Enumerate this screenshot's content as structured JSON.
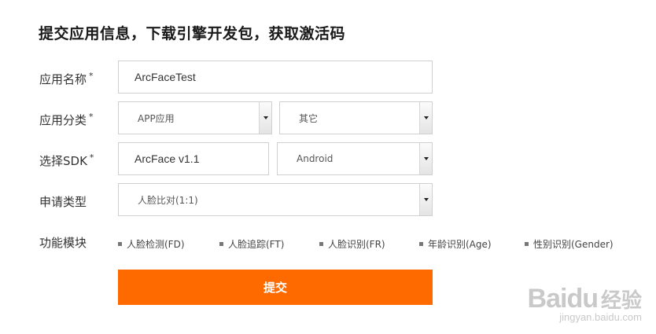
{
  "title": "提交应用信息，下载引擎开发包，获取激活码",
  "form": {
    "app_name": {
      "label": "应用名称",
      "required_mark": "*",
      "value": "ArcFaceTest"
    },
    "app_category": {
      "label": "应用分类",
      "required_mark": "*",
      "primary": "APP应用",
      "secondary": "其它"
    },
    "sdk": {
      "label": "选择SDK",
      "required_mark": "*",
      "version": "ArcFace v1.1",
      "platform": "Android"
    },
    "apply_type": {
      "label": "申请类型",
      "value": "人脸比对(1:1)"
    },
    "modules": {
      "label": "功能模块",
      "items": [
        "人脸检测(FD)",
        "人脸追踪(FT)",
        "人脸识别(FR)",
        "年龄识别(Age)",
        "性别识别(Gender)"
      ]
    },
    "submit_label": "提交"
  },
  "watermark": {
    "logo": "Bai",
    "logo_suffix": "du",
    "logo_cn": "经验",
    "url": "jingyan.baidu.com"
  },
  "colors": {
    "accent": "#ff6a00",
    "border": "#d0d0d0"
  }
}
